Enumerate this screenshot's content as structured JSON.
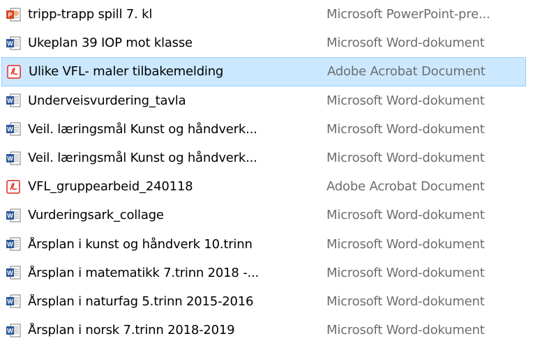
{
  "files": [
    {
      "name": "tripp-trapp spill 7. kl",
      "type": "Microsoft PowerPoint-pre...",
      "icon": "powerpoint-file-icon",
      "selected": false
    },
    {
      "name": "Ukeplan 39 IOP mot klasse",
      "type": "Microsoft Word-dokument",
      "icon": "word-file-icon",
      "selected": false
    },
    {
      "name": "Ulike VFL- maler tilbakemelding",
      "type": "Adobe Acrobat Document",
      "icon": "pdf-file-icon",
      "selected": true
    },
    {
      "name": "Underveisvurdering_tavla",
      "type": "Microsoft Word-dokument",
      "icon": "word-file-icon",
      "selected": false
    },
    {
      "name": "Veil. læringsmål Kunst og håndverk...",
      "type": "Microsoft Word-dokument",
      "icon": "word-file-icon",
      "selected": false
    },
    {
      "name": "Veil. læringsmål Kunst og håndverk...",
      "type": "Microsoft Word-dokument",
      "icon": "word-file-icon",
      "selected": false
    },
    {
      "name": "VFL_gruppearbeid_240118",
      "type": "Adobe Acrobat Document",
      "icon": "pdf-file-icon",
      "selected": false
    },
    {
      "name": "Vurderingsark_collage",
      "type": "Microsoft Word-dokument",
      "icon": "word-file-icon",
      "selected": false
    },
    {
      "name": "Årsplan i kunst og håndverk 10.trinn",
      "type": "Microsoft Word-dokument",
      "icon": "word-file-icon",
      "selected": false
    },
    {
      "name": "Årsplan i matematikk 7.trinn 2018 -...",
      "type": "Microsoft Word-dokument",
      "icon": "word-file-icon",
      "selected": false
    },
    {
      "name": "Årsplan i naturfag 5.trinn 2015-2016",
      "type": "Microsoft Word-dokument",
      "icon": "word-file-icon",
      "selected": false
    },
    {
      "name": "Årsplan i norsk 7.trinn 2018-2019",
      "type": "Microsoft Word-dokument",
      "icon": "word-file-icon",
      "selected": false
    }
  ],
  "colors": {
    "selection_bg": "#cce8ff",
    "selection_border": "#99d1ff",
    "type_text": "#6d6d6d",
    "word_blue": "#2b579a",
    "powerpoint_red": "#d24726",
    "pdf_red": "#e2231a"
  }
}
